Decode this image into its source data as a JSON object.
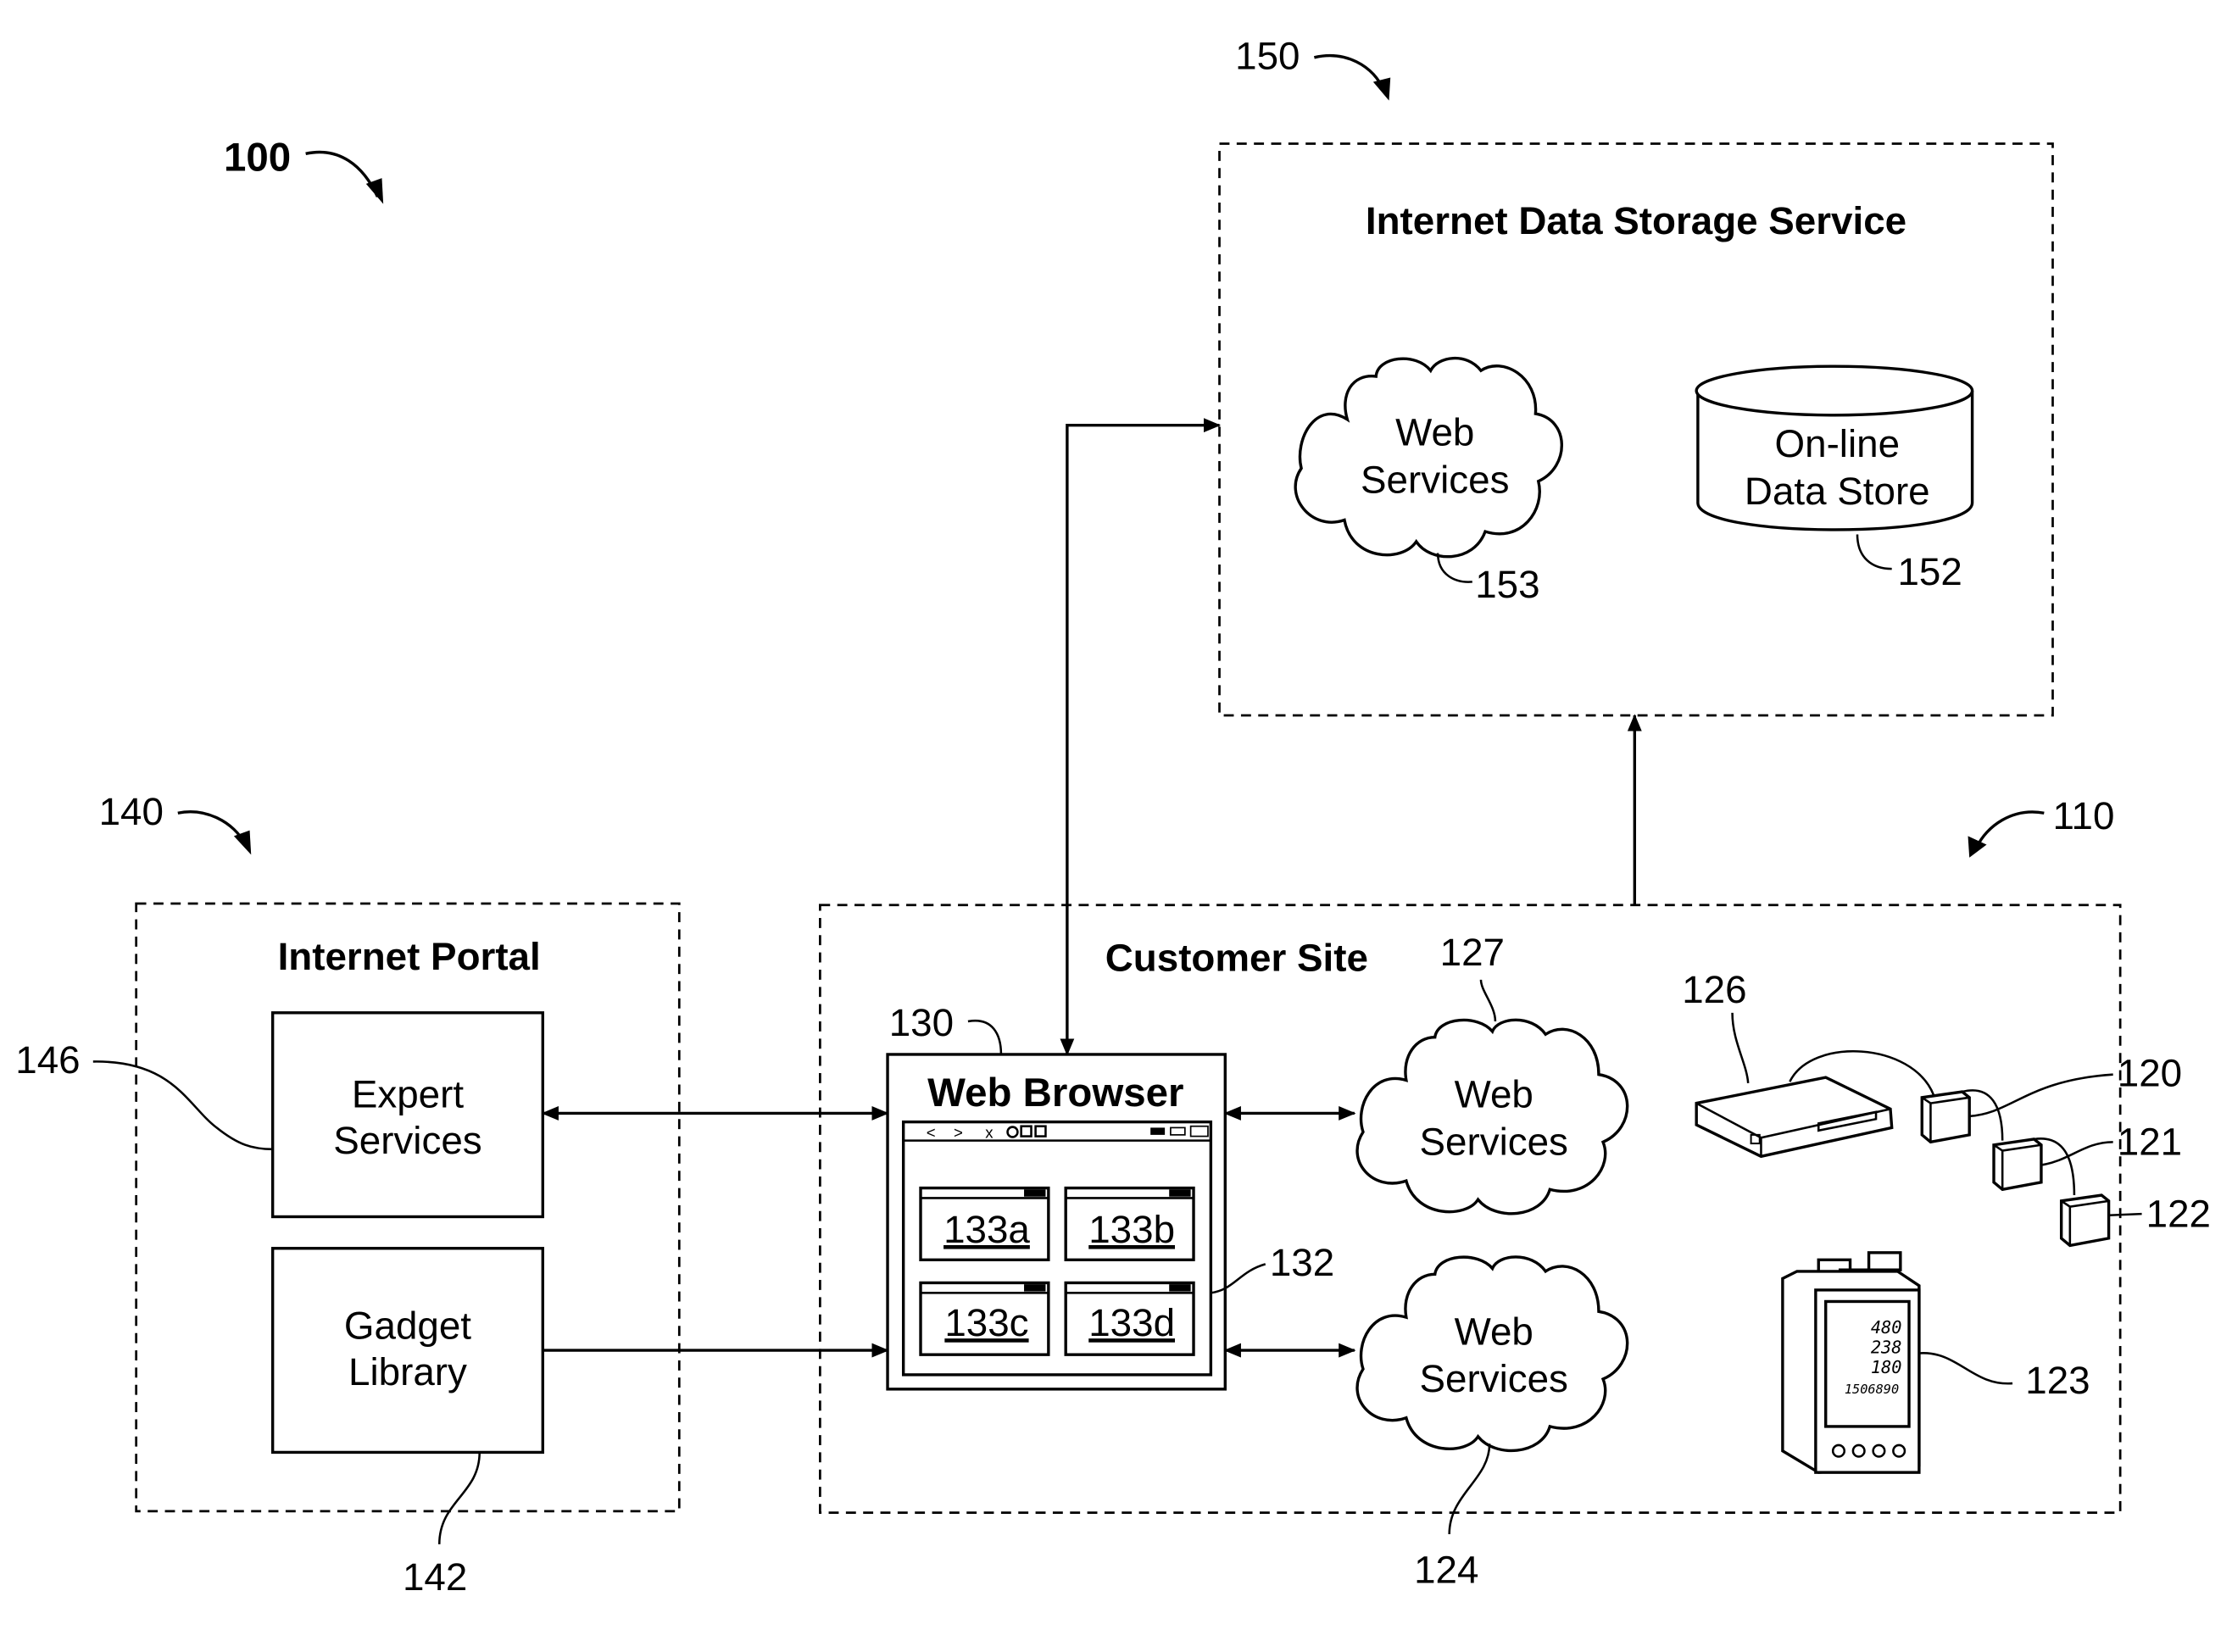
{
  "figure": {
    "ref": "100"
  },
  "storage": {
    "ref": "150",
    "title": "Internet Data Storage Service",
    "web_services": {
      "line1": "Web",
      "line2": "Services",
      "ref": "153"
    },
    "data_store": {
      "line1": "On-line",
      "line2": "Data Store",
      "ref": "152"
    }
  },
  "portal": {
    "ref": "140",
    "title": "Internet Portal",
    "expert": {
      "line1": "Expert",
      "line2": "Services",
      "ref": "146"
    },
    "gadget": {
      "line1": "Gadget",
      "line2": "Library",
      "ref": "142"
    }
  },
  "customer": {
    "ref": "110",
    "title": "Customer Site",
    "browser": {
      "ref": "130",
      "title": "Web Browser",
      "toolbar": {
        "back": "<",
        "forward": ">",
        "stop": "x"
      },
      "content_ref": "132",
      "gadgets": [
        "133a",
        "133b",
        "133c",
        "133d"
      ]
    },
    "web_services_top": {
      "line1": "Web",
      "line2": "Services",
      "ref": "127"
    },
    "web_services_bottom": {
      "line1": "Web",
      "line2": "Services",
      "ref": "124"
    },
    "gateway": {
      "ref": "126"
    },
    "sensors": [
      {
        "ref": "120"
      },
      {
        "ref": "121"
      },
      {
        "ref": "122"
      }
    ],
    "meter": {
      "ref": "123",
      "readings": [
        "480",
        "238",
        "180",
        "1506890"
      ]
    }
  }
}
